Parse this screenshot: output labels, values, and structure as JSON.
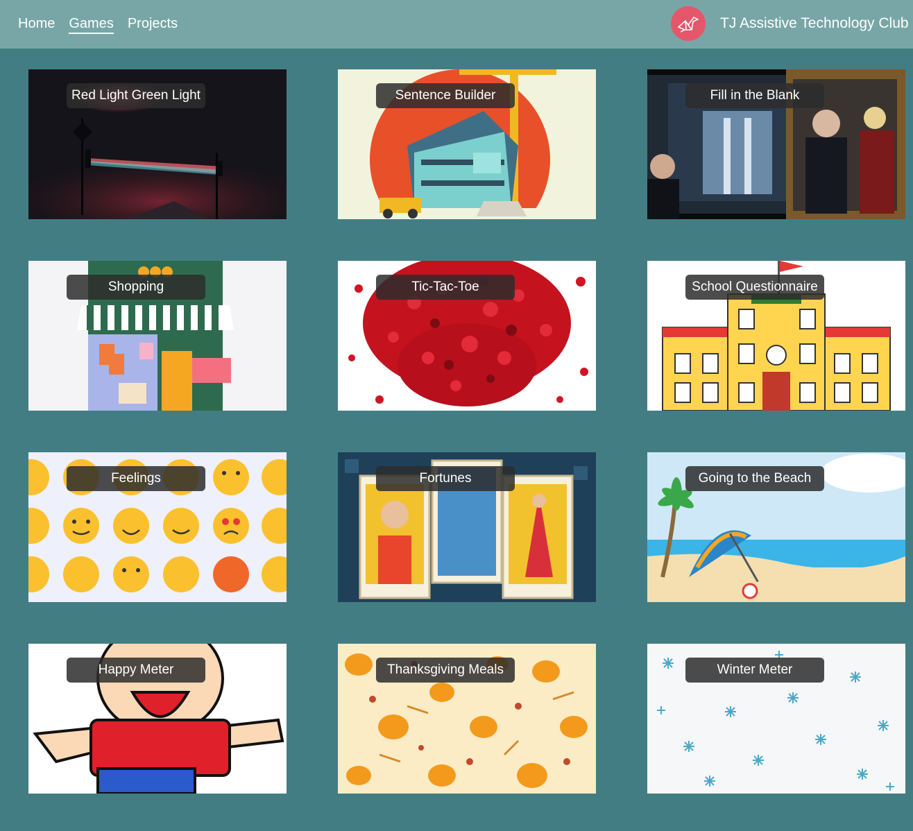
{
  "nav": {
    "items": [
      {
        "label": "Home",
        "active": false
      },
      {
        "label": "Games",
        "active": true
      },
      {
        "label": "Projects",
        "active": false
      }
    ]
  },
  "brand": {
    "name": "TJ Assistive Technology Club",
    "logo_icon": "origami-crane-icon",
    "logo_color": "#e4576b"
  },
  "colors": {
    "background": "#437d84",
    "topbar": "#78a6a7",
    "label_background": "#2d2d2d"
  },
  "games": [
    {
      "title": "Red Light Green Light",
      "image": "foggy-traffic-lights-night"
    },
    {
      "title": "Sentence Builder",
      "image": "construction-site-crane-illustration"
    },
    {
      "title": "Fill in the Blank",
      "image": "men-in-suits-film-still"
    },
    {
      "title": "Shopping",
      "image": "storefront-awning-illustration"
    },
    {
      "title": "Tic-Tac-Toe",
      "image": "red-hearts-cluster"
    },
    {
      "title": "School Questionnaire",
      "image": "yellow-school-building"
    },
    {
      "title": "Feelings",
      "image": "emoji-faces-pattern"
    },
    {
      "title": "Fortunes",
      "image": "tarot-cards"
    },
    {
      "title": "Going to the Beach",
      "image": "beach-palm-umbrella"
    },
    {
      "title": "Happy Meter",
      "image": "laughing-cartoon-boy"
    },
    {
      "title": "Thanksgiving Meals",
      "image": "pumpkin-leaves-pattern"
    },
    {
      "title": "Winter Meter",
      "image": "snowflakes-pattern"
    }
  ]
}
